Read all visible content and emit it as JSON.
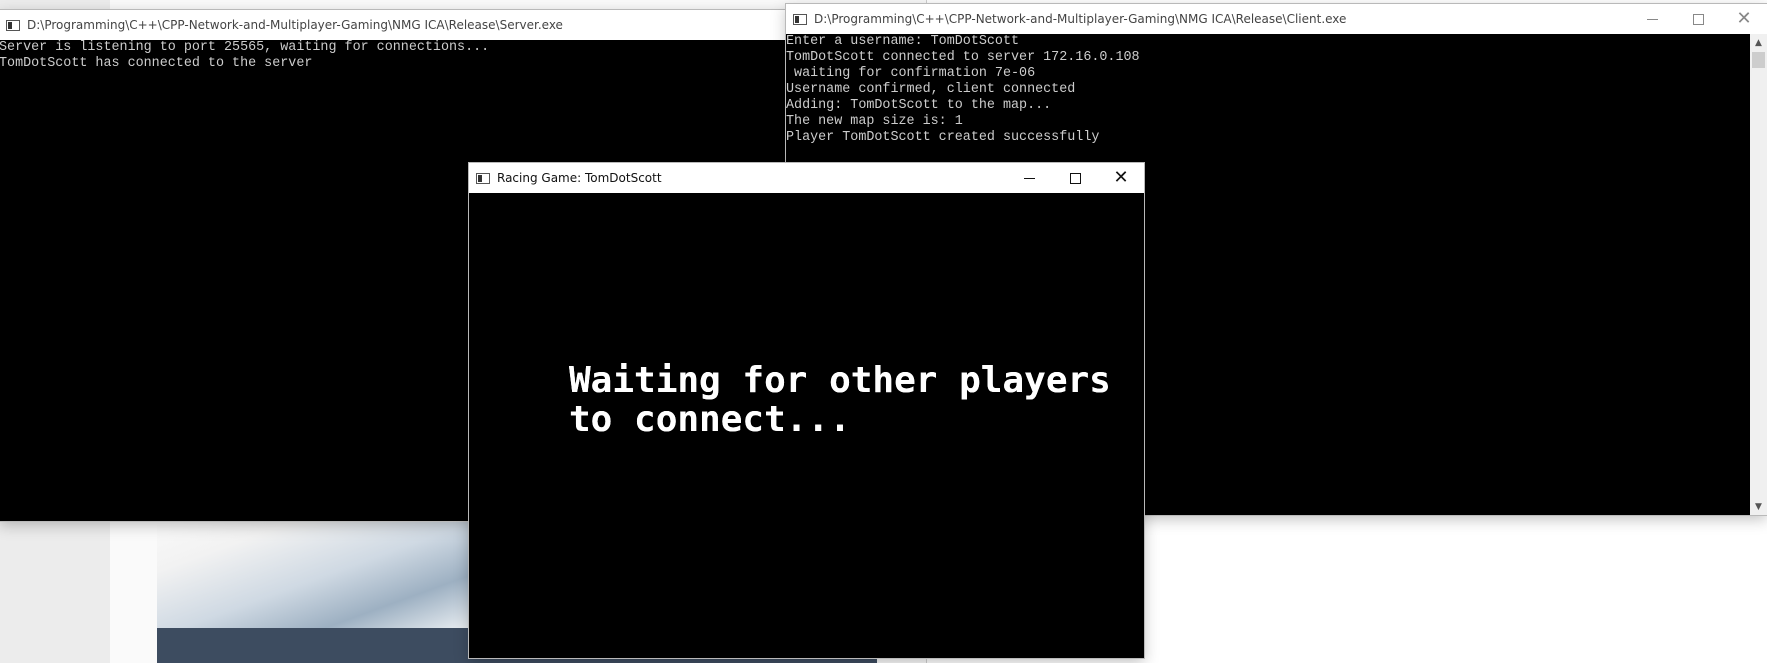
{
  "server_window": {
    "title": "D:\\Programming\\C++\\CPP-Network-and-Multiplayer-Gaming\\NMG ICA\\Release\\Server.exe",
    "lines": [
      "Server is listening to port 25565, waiting for connections...",
      "TomDotScott has connected to the server"
    ]
  },
  "client_window": {
    "title": "D:\\Programming\\C++\\CPP-Network-and-Multiplayer-Gaming\\NMG ICA\\Release\\Client.exe",
    "lines": [
      "Enter a username: TomDotScott",
      "TomDotScott connected to server 172.16.0.108",
      " waiting for confirmation 7e-06",
      "Username confirmed, client connected",
      "Adding: TomDotScott to the map...",
      "The new map size is: 1",
      "Player TomDotScott created successfully"
    ]
  },
  "game_window": {
    "title": "Racing Game: TomDotScott",
    "message_line1": "Waiting for other players",
    "message_line2": "to connect..."
  },
  "icons": {
    "window_icon": "console-window-icon",
    "minimize": "minimize-icon",
    "maximize": "maximize-icon",
    "close": "close-icon",
    "scroll_up": "scroll-up-arrow-icon",
    "scroll_down": "scroll-down-arrow-icon"
  },
  "colors": {
    "console_bg": "#000000",
    "console_text": "#cccccc",
    "game_text": "#ffffff",
    "titlebar_bg": "#ffffff"
  }
}
